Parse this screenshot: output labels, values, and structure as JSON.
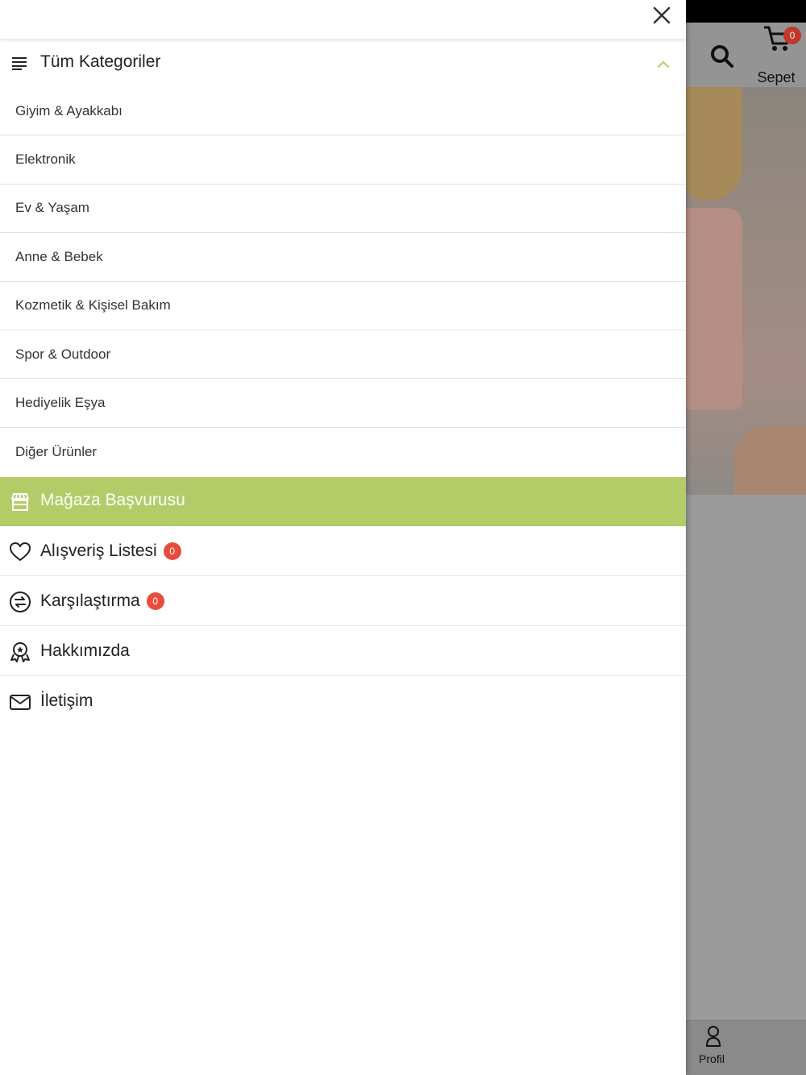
{
  "background": {
    "cart_badge": "0",
    "cart_label": "Sepet",
    "profile_label": "Profil"
  },
  "drawer": {
    "close_icon": "close-icon",
    "categories_header": {
      "title": "Tüm Kategoriler",
      "icon": "menu-lines-icon",
      "expanded_icon": "chevron-up-icon"
    },
    "categories": [
      {
        "label": "Giyim & Ayakkabı"
      },
      {
        "label": "Elektronik"
      },
      {
        "label": "Ev & Yaşam"
      },
      {
        "label": "Anne & Bebek"
      },
      {
        "label": "Kozmetik & Kişisel Bakım"
      },
      {
        "label": "Spor & Outdoor"
      },
      {
        "label": "Hediyelik Eşya"
      },
      {
        "label": "Diğer Ürünler"
      }
    ],
    "store_application": {
      "label": "Mağaza Başvurusu",
      "icon": "store-icon",
      "color": "#b4cc68"
    },
    "menu": [
      {
        "label": "Alışveriş Listesi",
        "icon": "heart-icon",
        "badge": "0"
      },
      {
        "label": "Karşılaştırma",
        "icon": "compare-icon",
        "badge": "0"
      },
      {
        "label": "Hakkımızda",
        "icon": "about-icon"
      },
      {
        "label": "İletişim",
        "icon": "mail-icon"
      }
    ],
    "badge_color": "#e84c3d"
  }
}
